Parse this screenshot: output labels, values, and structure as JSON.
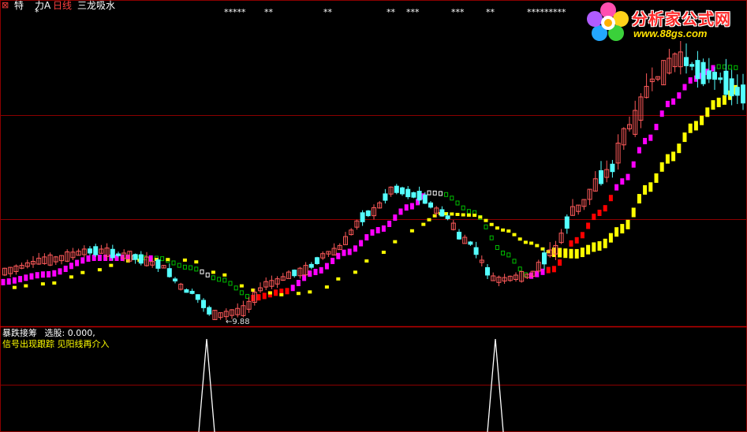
{
  "header": {
    "close_glyph": "⊠",
    "items": [
      {
        "label": "特",
        "color": "#ffffff"
      },
      {
        "label": "力A",
        "color": "#ffffff"
      },
      {
        "label": "日线",
        "color": "#ff4040"
      },
      {
        "label": "三龙吸水",
        "color": "#ffffff"
      }
    ]
  },
  "top_markers": {
    "m1": "*",
    "m2": "*****",
    "m3": "**",
    "m4": "**",
    "m5": "**",
    "m6": "***",
    "m7": "***",
    "m8": "**",
    "m9": "*********"
  },
  "logo": {
    "name": "分析家公式网",
    "url": "www.88gs.com"
  },
  "low_label": "←9.88",
  "indicator": {
    "line1_name": "暴跌接筹",
    "line1_value": "选股: 0.000,",
    "line2": "信号出现跟踪 见阳线再介入"
  },
  "colors": {
    "background": "#000000",
    "grid": "#8b0000",
    "up_candle": "#ff5a5a",
    "down_candle": "#54ffff",
    "ma_magenta": "#ff00ff",
    "ma_red": "#ff0000",
    "ma_yellow": "#ffff00",
    "ma_green": "#00c000",
    "ma_white": "#ffffff",
    "signal": "#ffffff"
  },
  "signals": {
    "count": 2,
    "description_text": ""
  }
}
